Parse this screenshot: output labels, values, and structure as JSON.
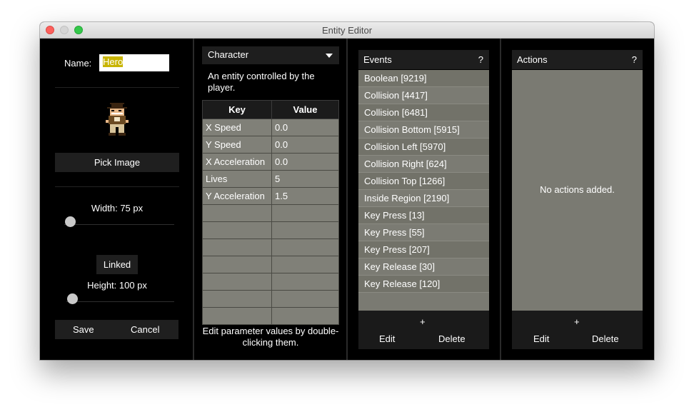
{
  "window": {
    "title": "Entity Editor"
  },
  "left": {
    "name_label": "Name:",
    "name_value": "Hero",
    "pick_image": "Pick Image",
    "width_label": "Width: 75 px",
    "linked": "Linked",
    "height_label": "Height: 100 px",
    "save": "Save",
    "cancel": "Cancel",
    "width_slider_level": 0.05,
    "height_slider_level": 0.05
  },
  "character": {
    "dropdown_value": "Character",
    "description": "An entity controlled by the player.",
    "table": {
      "headers": [
        "Key",
        "Value"
      ],
      "rows": [
        [
          "X Speed",
          "0.0"
        ],
        [
          "Y Speed",
          "0.0"
        ],
        [
          "X Acceleration",
          "0.0"
        ],
        [
          "Lives",
          "5"
        ],
        [
          "Y Acceleration",
          "1.5"
        ]
      ]
    },
    "hint": "Edit parameter values by double-clicking them."
  },
  "events": {
    "title": "Events",
    "help": "?",
    "items": [
      "Boolean  [9219]",
      "Collision [4417]",
      "Collision [6481]",
      "Collision Bottom  [5915]",
      "Collision Left [5970]",
      "Collision Right  [624]",
      "Collision Top  [1266]",
      "Inside Region [2190]",
      "Key Press [13]",
      "Key Press [55]",
      "Key Press [207]",
      "Key Release [30]",
      "Key Release [120]"
    ],
    "add": "+",
    "edit": "Edit",
    "delete": "Delete"
  },
  "actions": {
    "title": "Actions",
    "help": "?",
    "empty": "No actions added.",
    "add": "+",
    "edit": "Edit",
    "delete": "Delete"
  }
}
